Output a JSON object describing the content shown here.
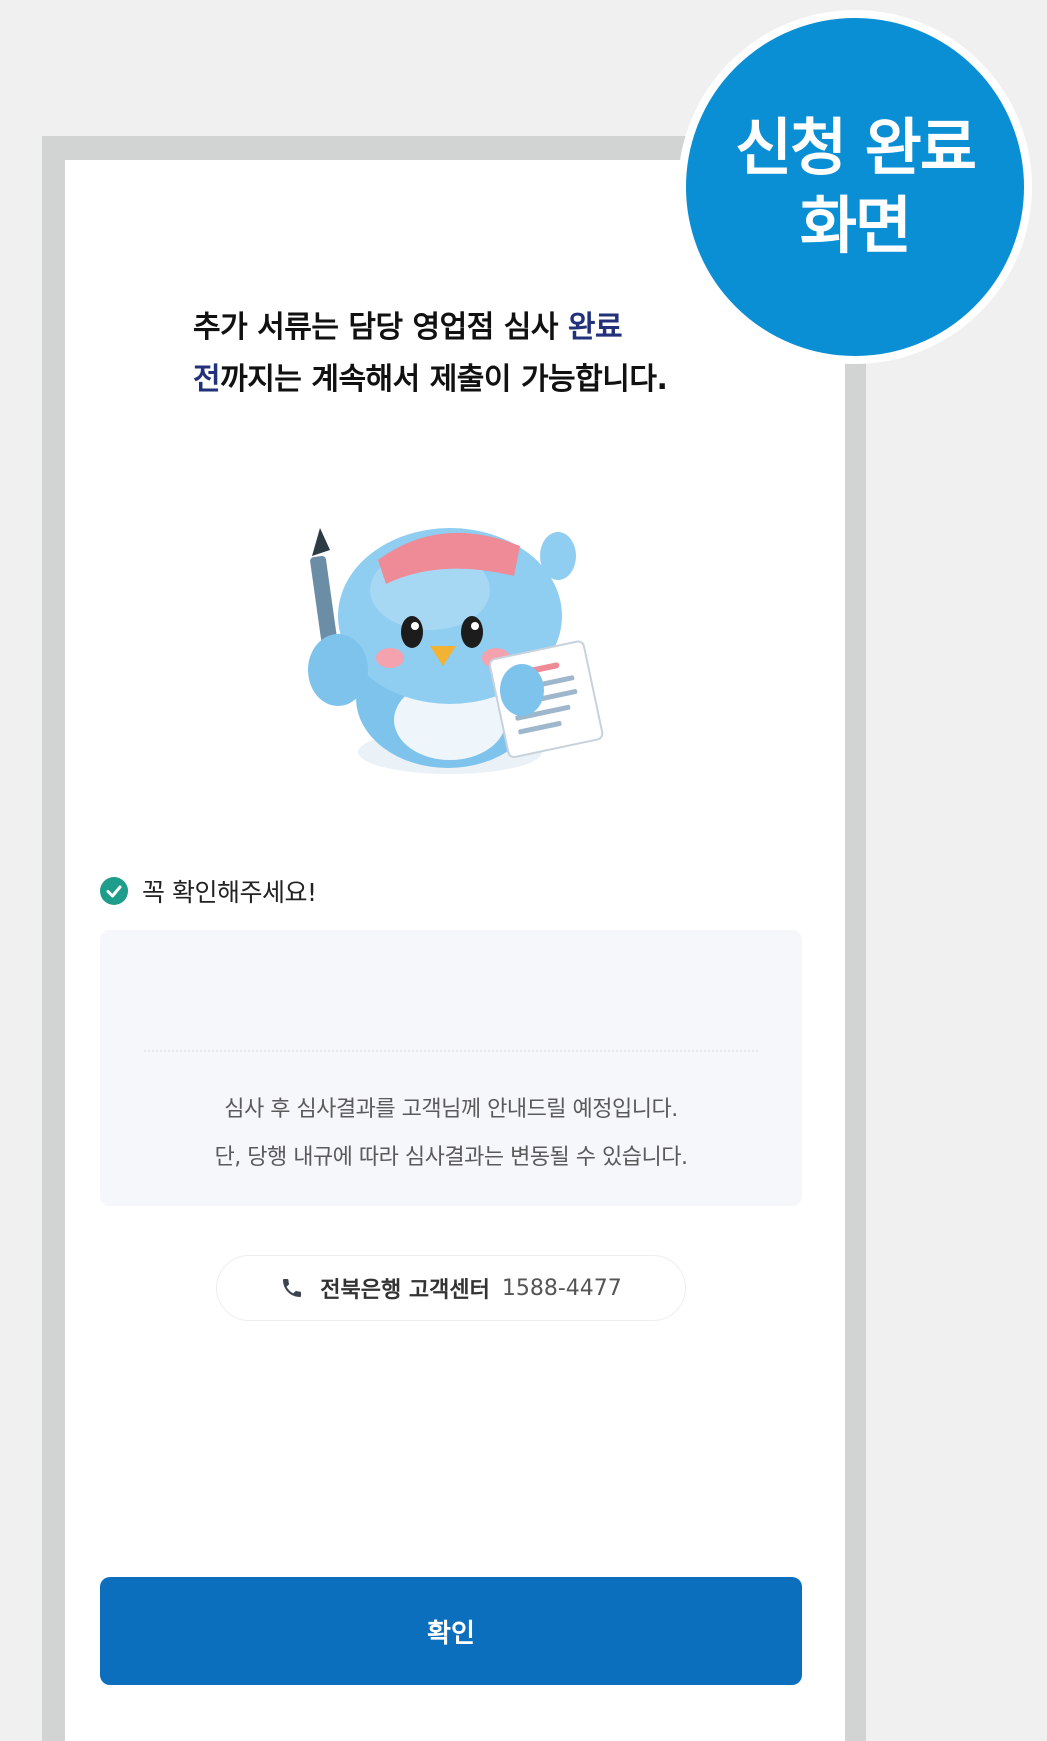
{
  "badge": {
    "line1": "신청 완료",
    "line2": "화면"
  },
  "headline": {
    "part1": "추가 서류는 담당 영업점 심사 ",
    "accent1": "완료",
    "accent2": "전",
    "part2": "까지는 계속해서 제출이 가능합니다."
  },
  "notice": {
    "title": "꼭 확인해주세요!",
    "line1": "심사 후 심사결과를 고객님께 안내드릴 예정입니다.",
    "line2": "단, 당행 내규에 따라 심사결과는 변동될 수 있습니다."
  },
  "contact": {
    "name": "전북은행 고객센터",
    "number": "1588-4477"
  },
  "confirm_label": "확인",
  "colors": {
    "badge": "#0a8fd4",
    "primary_button": "#0b6fbd",
    "check": "#1e9e8a",
    "accent_text": "#22317a"
  },
  "icons": {
    "check": "check-circle-icon",
    "phone": "phone-icon",
    "mascot": "bird-mascot-illustration"
  }
}
